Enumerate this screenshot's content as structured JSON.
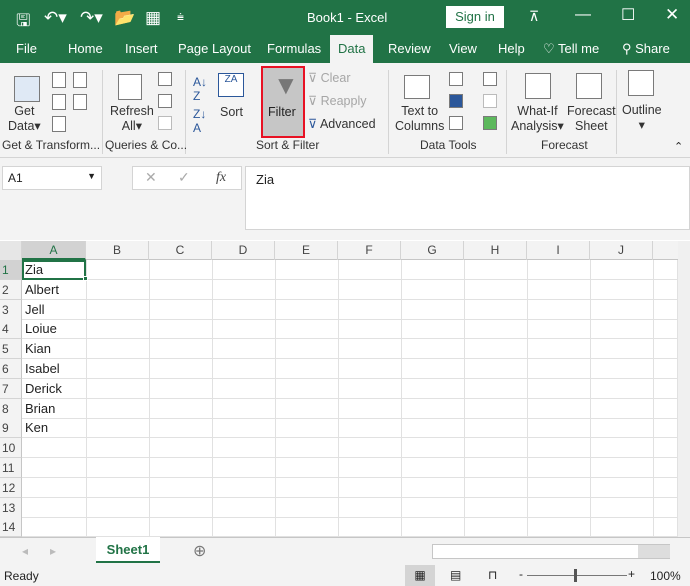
{
  "title_bar": {
    "title": "Book1  -  Excel",
    "sign_in": "Sign in"
  },
  "tabs": [
    "File",
    "Home",
    "Insert",
    "Page Layout",
    "Formulas",
    "Data",
    "Review",
    "View",
    "Help",
    "Tell me",
    "Share"
  ],
  "ribbon": {
    "get_data": [
      "Get",
      "Data"
    ],
    "refresh": [
      "Refresh",
      "All"
    ],
    "sort": "Sort",
    "filter": "Filter",
    "clear": "Clear",
    "reapply": "Reapply",
    "advanced": "Advanced",
    "text_to_columns": [
      "Text to",
      "Columns"
    ],
    "what_if": [
      "What-If",
      "Analysis"
    ],
    "forecast_sheet": [
      "Forecast",
      "Sheet"
    ],
    "outline": "Outline",
    "groups": [
      "Get & Transform...",
      "Queries & Co...",
      "Sort & Filter",
      "Data Tools",
      "Forecast"
    ]
  },
  "formula_bar": {
    "name_box": "A1",
    "fx": "fx",
    "value": "Zia"
  },
  "columns": [
    "A",
    "B",
    "C",
    "D",
    "E",
    "F",
    "G",
    "H",
    "I",
    "J"
  ],
  "rows": [
    "1",
    "2",
    "3",
    "4",
    "5",
    "6",
    "7",
    "8",
    "9",
    "10",
    "11",
    "12",
    "13",
    "14"
  ],
  "cells_A": [
    "Zia",
    "Albert",
    "Jell",
    "Loiue",
    "Kian",
    "Isabel",
    "Derick",
    "Brian",
    "Ken"
  ],
  "sheet_tab": "Sheet1",
  "status": {
    "ready": "Ready",
    "zoom": "100%"
  },
  "colors": {
    "brand": "#217346",
    "highlight": "#e81123"
  }
}
